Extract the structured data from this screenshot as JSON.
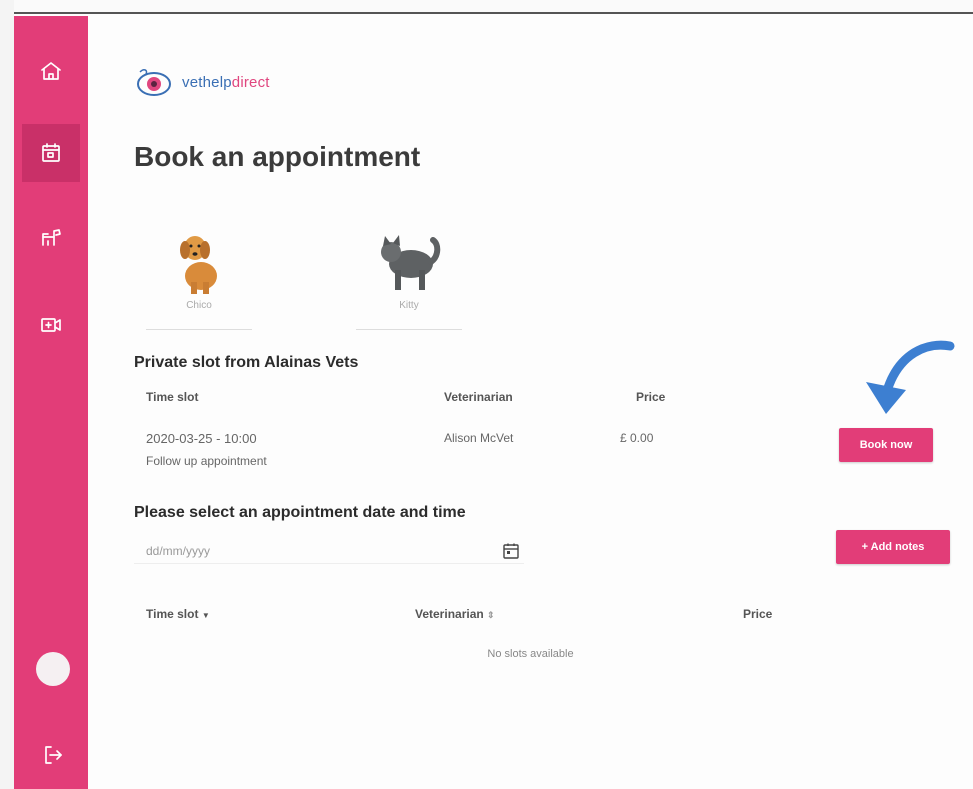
{
  "sidebar": {
    "items": [
      {
        "name": "home",
        "icon": "home-icon"
      },
      {
        "name": "appointments",
        "icon": "calendar-icon",
        "active": true
      },
      {
        "name": "pets",
        "icon": "dog-icon"
      },
      {
        "name": "video",
        "icon": "video-plus-icon"
      }
    ],
    "logout_icon": "logout-icon",
    "color": "#e23d78"
  },
  "logo": {
    "part1": "vethelp",
    "part2": "direct"
  },
  "page": {
    "title": "Book an appointment"
  },
  "pets": [
    {
      "name": "Chico",
      "icon": "dog-photo"
    },
    {
      "name": "Kitty",
      "icon": "cat-photo"
    }
  ],
  "private_slot": {
    "title": "Private slot from Alainas Vets",
    "headers": {
      "time": "Time slot",
      "vet": "Veterinarian",
      "price": "Price"
    },
    "row": {
      "time": "2020-03-25 - 10:00",
      "type": "Follow up appointment",
      "vet": "Alison McVet",
      "price": "£ 0.00"
    },
    "book_label": "Book now"
  },
  "select": {
    "title": "Please select an appointment date and time",
    "date_placeholder": "dd/mm/yyyy",
    "add_notes_label": "+ Add notes",
    "headers": {
      "time": "Time slot",
      "vet": "Veterinarian",
      "price": "Price"
    },
    "empty": "No slots available"
  },
  "colors": {
    "accent": "#e23d78",
    "arrow": "#3d7fd1"
  }
}
